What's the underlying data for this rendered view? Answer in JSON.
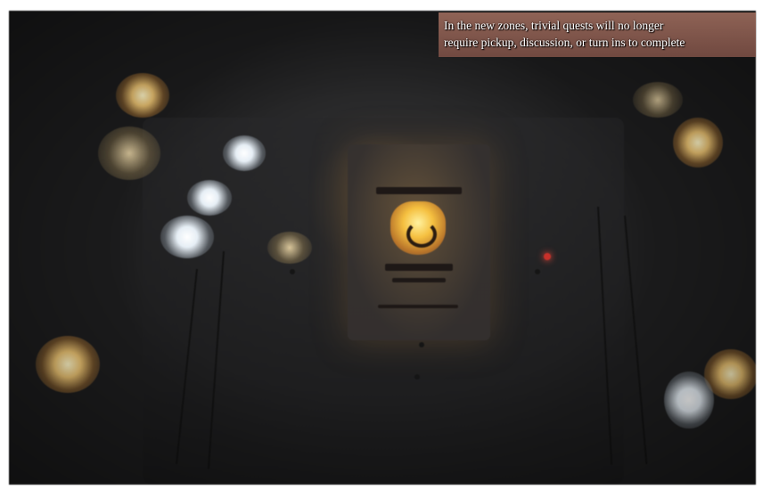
{
  "hud": {
    "tip_line1": "In the new zones, trivial quests will no longer",
    "tip_line2": "require pickup, discussion, or turn ins to complete"
  },
  "colors": {
    "tip_background": "#a06e5f",
    "tip_text": "#ffffff",
    "scene_base": "#2a2a2b",
    "shrine_glow": "#f5c040"
  }
}
